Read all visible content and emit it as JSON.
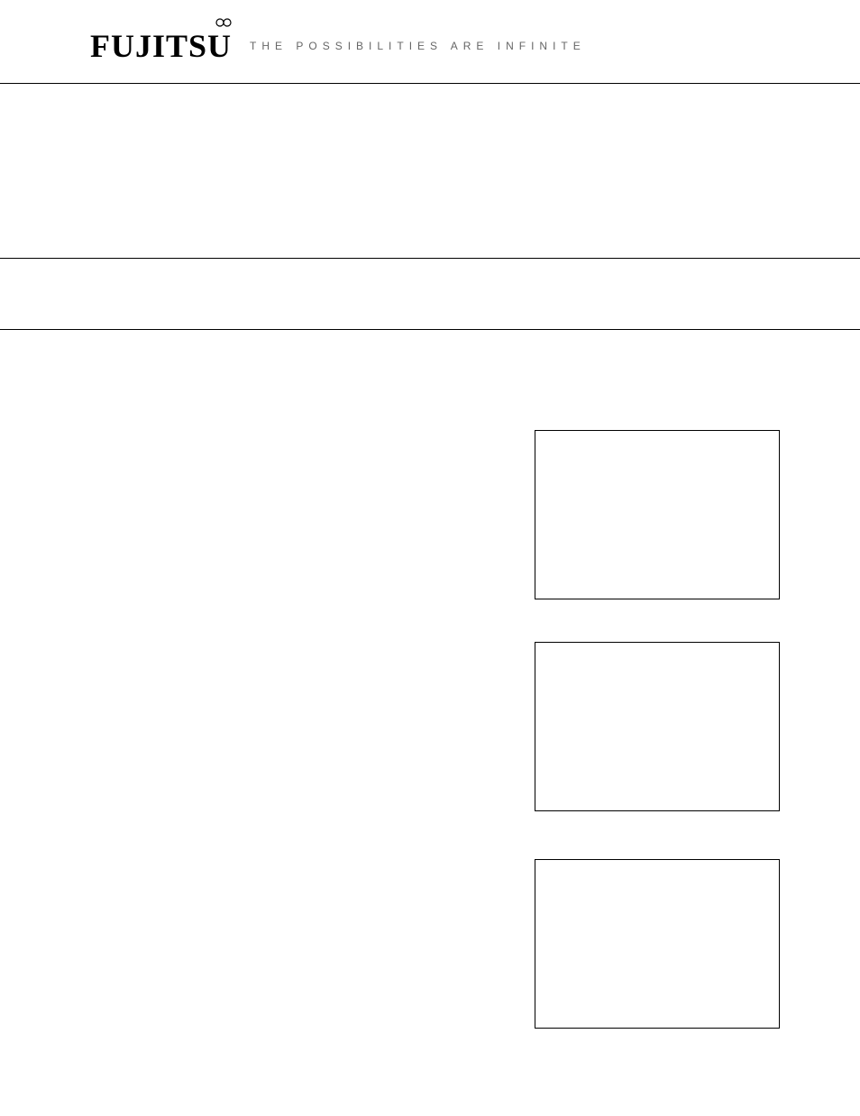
{
  "header": {
    "logo_text": "FUJITSU",
    "tagline": "THE POSSIBILITIES ARE INFINITE"
  }
}
